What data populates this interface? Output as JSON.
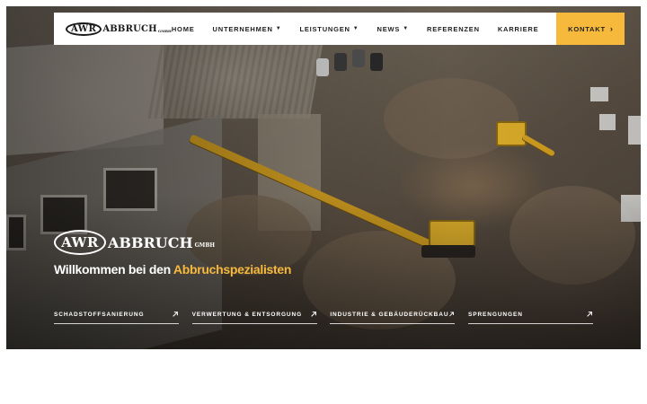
{
  "brand": {
    "mark": "AWR",
    "word": "ABBRUCH",
    "suffix": "GMBH"
  },
  "nav": {
    "items": [
      {
        "label": "HOME",
        "dropdown": false
      },
      {
        "label": "UNTERNEHMEN",
        "dropdown": true
      },
      {
        "label": "LEISTUNGEN",
        "dropdown": true
      },
      {
        "label": "NEWS",
        "dropdown": true
      },
      {
        "label": "REFERENZEN",
        "dropdown": false
      },
      {
        "label": "KARRIERE",
        "dropdown": false
      }
    ],
    "cta": "KONTAKT"
  },
  "hero": {
    "headline_start": "Willkommen bei den ",
    "headline_accent": "Abbruchspezialisten",
    "services": [
      {
        "label": "SCHADSTOFFSANIERUNG",
        "icon": "arrow-up-right-icon"
      },
      {
        "label": "VERWERTUNG & ENTSORGUNG",
        "icon": "arrow-up-right-icon"
      },
      {
        "label": "INDUSTRIE & GEBÄUDERÜCKBAU",
        "icon": "arrow-up-right-icon"
      },
      {
        "label": "SPRENGUNGEN",
        "icon": "arrow-up-right-icon"
      }
    ]
  },
  "colors": {
    "accent": "#f6b93b",
    "nav_bg": "#ffffff",
    "text_dark": "#1f1f1f"
  }
}
